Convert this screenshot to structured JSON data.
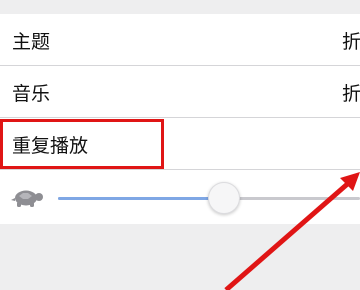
{
  "settings": {
    "rows": [
      {
        "label": "主题",
        "value": "折"
      },
      {
        "label": "音乐",
        "value": "折"
      },
      {
        "label": "重复播放"
      }
    ],
    "speed": {
      "min_icon": "turtle-icon",
      "value": 0.55
    }
  },
  "annotation": {
    "color": "#e01515"
  },
  "colors": {
    "accent": "#7fa7e5",
    "background": "#eeeeef"
  }
}
